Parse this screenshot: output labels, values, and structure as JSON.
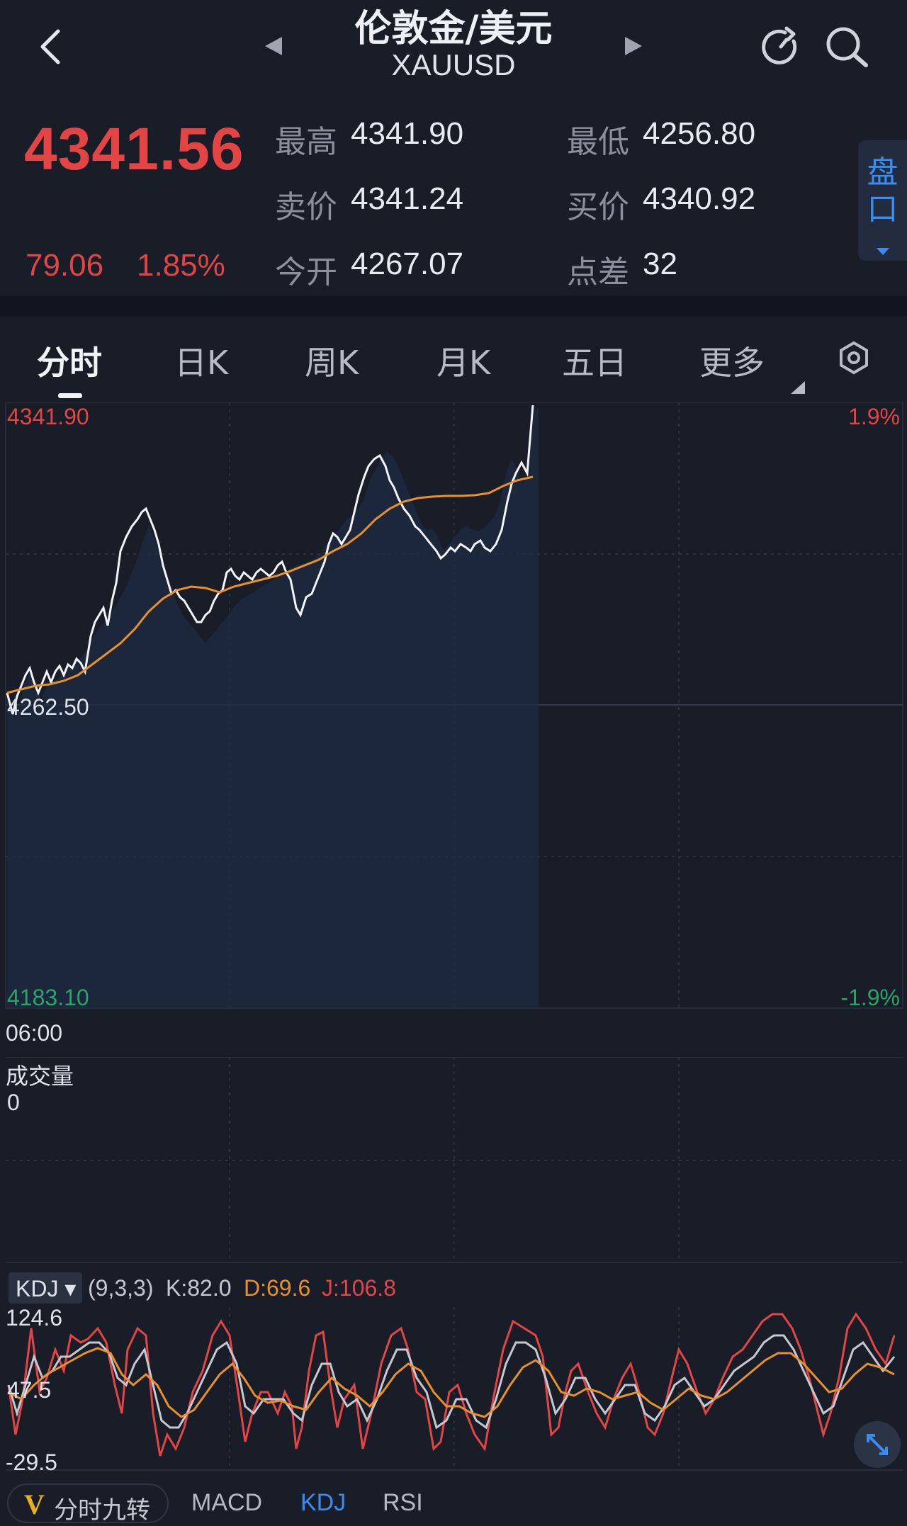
{
  "header": {
    "title": "伦敦金/美元",
    "symbol": "XAUUSD",
    "price": "4341.56",
    "change": "79.06",
    "change_pct": "1.85%",
    "pankou": [
      "盘",
      "口"
    ],
    "stats": [
      {
        "label": "最高",
        "value": "4341.90"
      },
      {
        "label": "最低",
        "value": "4256.80"
      },
      {
        "label": "卖价",
        "value": "4341.24"
      },
      {
        "label": "买价",
        "value": "4340.92"
      },
      {
        "label": "今开",
        "value": "4267.07"
      },
      {
        "label": "点差",
        "value": "32"
      }
    ],
    "colors": {
      "up": "#e34545",
      "down": "#27a56a",
      "accent": "#3a8cf0",
      "avg_line": "#e8902d"
    }
  },
  "tabs": [
    "分时",
    "日K",
    "周K",
    "月K",
    "五日",
    "更多"
  ],
  "main_chart": {
    "top_price": "4341.90",
    "mid_price": "4262.50",
    "bottom_price": "4183.10",
    "top_pct": "1.9%",
    "bottom_pct": "-1.9%",
    "time_label": "06:00"
  },
  "volume": {
    "label": "成交量",
    "value": "0"
  },
  "kdj": {
    "name": "KDJ ▾",
    "params": "(9,3,3)",
    "k": "K:82.0",
    "d": "D:69.6",
    "j": "J:106.8",
    "y_top": "124.6",
    "y_mid": "47.5",
    "y_bottom": "-29.5"
  },
  "bottom_tabs": [
    "分时九转",
    "MACD",
    "KDJ",
    "RSI"
  ],
  "icons": [
    "back-icon",
    "prev-arrow-icon",
    "next-arrow-icon",
    "refresh-icon",
    "search-icon",
    "settings-hex-icon",
    "expand-icon"
  ]
}
